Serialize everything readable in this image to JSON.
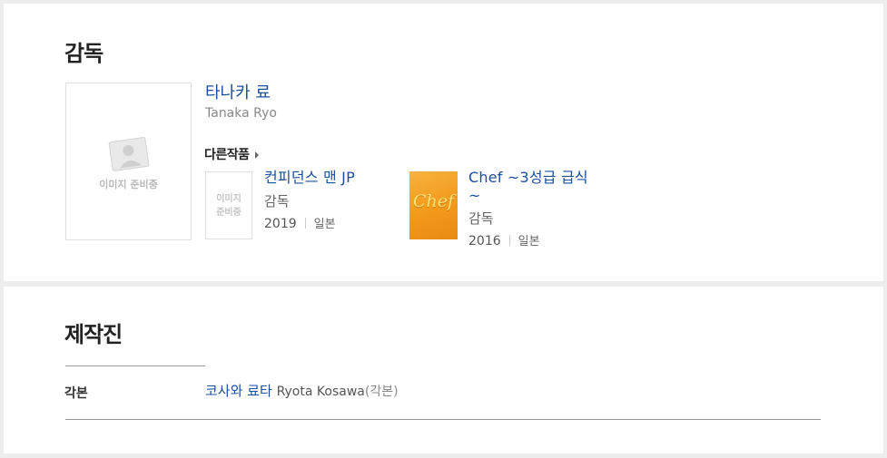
{
  "director": {
    "section_title": "감독",
    "photo_placeholder": "이미지 준비중",
    "name_ko": "타나카 료",
    "name_en": "Tanaka Ryo",
    "other_works_label": "다른작품",
    "works": [
      {
        "title": "컨피던스 맨 JP",
        "role": "감독",
        "year": "2019",
        "country": "일본",
        "thumb_placeholder": [
          "이미지",
          "준비중"
        ]
      },
      {
        "title": "Chef ~3성급 급식~",
        "role": "감독",
        "year": "2016",
        "country": "일본",
        "poster_text": "Chef"
      }
    ]
  },
  "staff": {
    "section_title": "제작진",
    "rows": [
      {
        "role_label": "각본",
        "name_ko": "코사와 료타",
        "name_en": "Ryota Kosawa",
        "role": "(각본)"
      }
    ]
  },
  "colors": {
    "link": "#1a4fa0",
    "poster": "#f29a1c",
    "background": "#ededed"
  }
}
